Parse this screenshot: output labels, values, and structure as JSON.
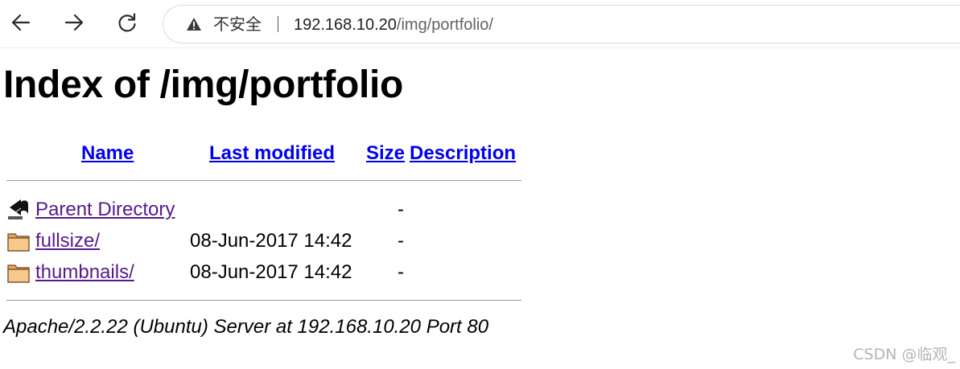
{
  "browser": {
    "security_label": "不安全",
    "url_host": "192.168.10.20",
    "url_path": "/img/portfolio/"
  },
  "page": {
    "title": "Index of /img/portfolio",
    "columns": {
      "name": "Name",
      "last_modified": "Last modified",
      "size": "Size",
      "description": "Description"
    },
    "rows": [
      {
        "icon": "back-arrow-icon",
        "name": "Parent Directory",
        "modified": "",
        "size": "-"
      },
      {
        "icon": "folder-icon",
        "name": "fullsize/",
        "modified": "08-Jun-2017 14:42",
        "size": "-"
      },
      {
        "icon": "folder-icon",
        "name": "thumbnails/",
        "modified": "08-Jun-2017 14:42",
        "size": "-"
      }
    ],
    "server_signature": "Apache/2.2.22 (Ubuntu) Server at 192.168.10.20 Port 80"
  },
  "watermark": "CSDN @临观_"
}
